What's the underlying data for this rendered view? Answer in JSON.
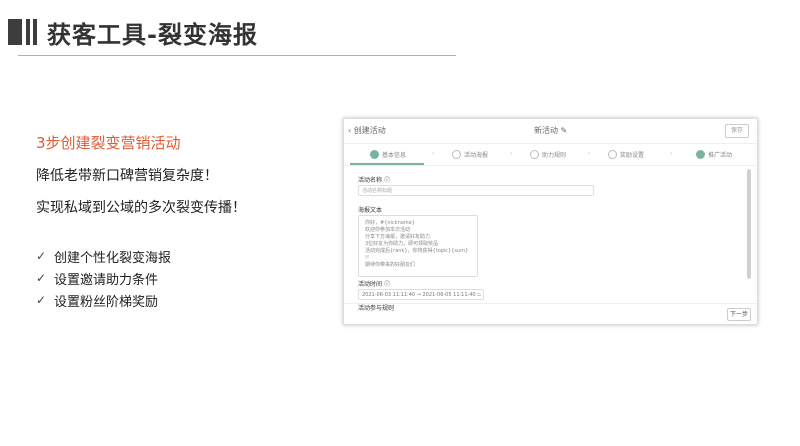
{
  "header": {
    "title": "获客工具-裂变海报"
  },
  "left": {
    "step_title": "3步创建裂变营销活动",
    "line1": "降低老带新口碑营销复杂度！",
    "line2": "实现私域到公域的多次裂变传播！",
    "checks": [
      "创建个性化裂变海报",
      "设置邀请助力条件",
      "设置粉丝阶梯奖励"
    ]
  },
  "screenshot": {
    "back_label": "创建活动",
    "center_title": "新活动",
    "save_label": "保存",
    "steps": [
      "基本信息",
      "活动海报",
      "助力规则",
      "奖励设置",
      "推广活动"
    ],
    "form": {
      "activity_name_label": "活动名称",
      "activity_name_placeholder": "活动名称标题",
      "poster_text_label": "海报文本",
      "poster_text_lines": [
        "你好，#{nickname}",
        "欢迎你参加本次活动",
        "分享下方海报，邀请好友助力",
        "3位好友为你助力，即可领取奖品",
        "活动完成后{rank}，你将获得{topic}{sum}",
        "!!",
        "期待你带来的好朋友们"
      ],
      "time_label": "活动时间",
      "time_start": "2021-06-03 11:11:40",
      "time_end": "2021-06-05 11:11:40",
      "next_label": "活动参与规则"
    },
    "next_button": "下一步"
  }
}
